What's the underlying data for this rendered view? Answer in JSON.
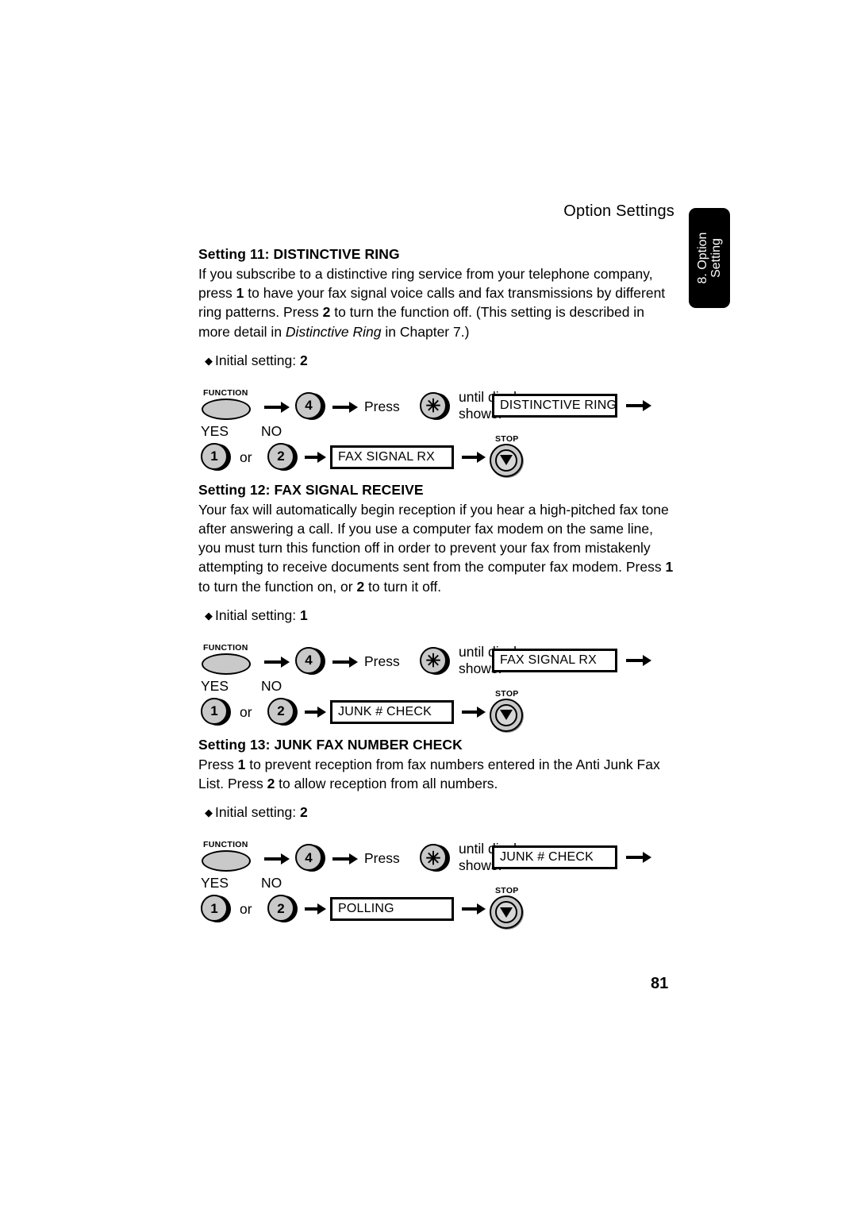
{
  "header": {
    "title": "Option Settings",
    "side_tab": "8. Option\nSetting"
  },
  "page_number": "81",
  "sections": [
    {
      "title": "Setting 11: DISTINCTIVE RING",
      "body_html": "If you subscribe to a distinctive ring service from your telephone company, press <b>1</b> to have your fax signal voice calls and fax transmissions by different ring patterns. Press <b>2</b> to turn the function off. (This setting is described in more detail in <i>Distinctive Ring</i> in Chapter 7.)",
      "initial_label": "Initial setting:",
      "initial_value": "2",
      "flow": {
        "function_label": "FUNCTION",
        "key_number": "4",
        "press_label": "Press",
        "star_key": "✳",
        "until_line1": "until display",
        "until_line2": "shows:",
        "display_top": "DISTINCTIVE RING",
        "yes_label": "YES",
        "no_label": "NO",
        "key_yes": "1",
        "or_label": "or",
        "key_no": "2",
        "display_bottom": "FAX SIGNAL RX",
        "stop_label": "STOP"
      }
    },
    {
      "title": "Setting 12: FAX SIGNAL RECEIVE",
      "body_html": "Your fax will automatically begin reception if you hear a high-pitched fax tone after answering a call. If you use a computer fax modem on the same line, you must turn this function off in order to prevent your fax from mistakenly attempting to receive documents sent from the computer fax modem. Press <b>1</b> to turn the function on, or <b>2</b> to turn it off.",
      "initial_label": "Initial setting:",
      "initial_value": "1",
      "flow": {
        "function_label": "FUNCTION",
        "key_number": "4",
        "press_label": "Press",
        "star_key": "✳",
        "until_line1": "until display",
        "until_line2": "shows:",
        "display_top": "FAX SIGNAL RX",
        "yes_label": "YES",
        "no_label": "NO",
        "key_yes": "1",
        "or_label": "or",
        "key_no": "2",
        "display_bottom": "JUNK # CHECK",
        "stop_label": "STOP"
      }
    },
    {
      "title": "Setting 13: JUNK FAX NUMBER CHECK",
      "body_html": "Press <b>1</b> to prevent reception from fax numbers entered in the Anti Junk Fax List. Press <b>2</b> to allow reception from all numbers.",
      "initial_label": "Initial setting:",
      "initial_value": "2",
      "flow": {
        "function_label": "FUNCTION",
        "key_number": "4",
        "press_label": "Press",
        "star_key": "✳",
        "until_line1": "until display",
        "until_line2": "shows:",
        "display_top": "JUNK # CHECK",
        "yes_label": "YES",
        "no_label": "NO",
        "key_yes": "1",
        "or_label": "or",
        "key_no": "2",
        "display_bottom": "POLLING",
        "stop_label": "STOP"
      }
    }
  ]
}
